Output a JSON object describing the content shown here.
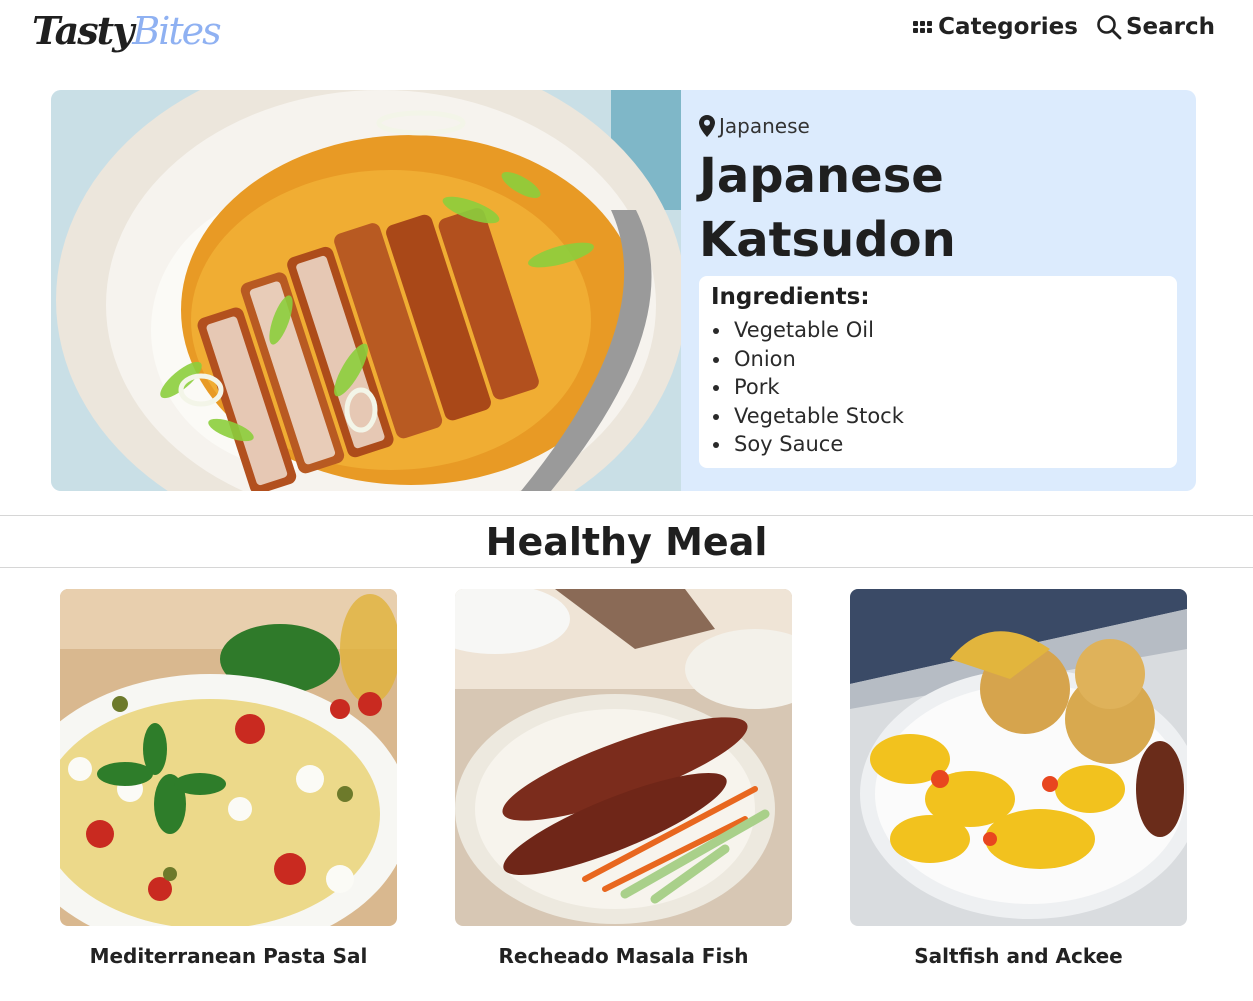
{
  "header": {
    "logo_part1": "Tasty",
    "logo_part2": "Bites",
    "nav": {
      "categories": "Categories",
      "search": "Search"
    }
  },
  "hero": {
    "cuisine": "Japanese",
    "title": "Japanese Katsudon",
    "ingredients_title": "Ingredients:",
    "ingredients": [
      "Vegetable Oil",
      "Onion",
      "Pork",
      "Vegetable Stock",
      "Soy Sauce"
    ]
  },
  "section": {
    "title": "Healthy Meal"
  },
  "cards": [
    {
      "label": "Mediterranean Pasta Sal"
    },
    {
      "label": "Recheado Masala Fish"
    },
    {
      "label": "Saltfish and Ackee"
    }
  ],
  "colors": {
    "hero_bg": "#dcebfd",
    "logo_accent": "#8fb1f2",
    "text": "#1f1f1f"
  }
}
